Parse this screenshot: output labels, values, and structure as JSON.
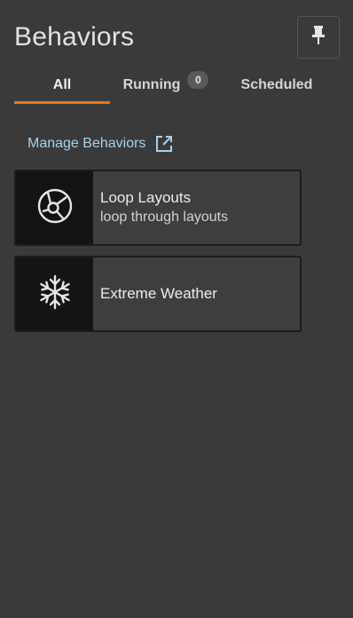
{
  "header": {
    "title": "Behaviors",
    "pin_icon": "pin-icon"
  },
  "tabs": [
    {
      "label": "All",
      "active": true
    },
    {
      "label": "Running",
      "badge": "0"
    },
    {
      "label": "Scheduled"
    }
  ],
  "manage_link": {
    "label": "Manage Behaviors",
    "icon": "external-link-icon",
    "color": "#a9d0ec"
  },
  "behaviors": [
    {
      "title": "Loop Layouts",
      "subtitle": "loop through layouts",
      "icon": "loop-layouts-icon"
    },
    {
      "title": "Extreme Weather",
      "subtitle": "",
      "icon": "snowflake-icon"
    }
  ],
  "colors": {
    "accent": "#e87722",
    "background": "#3a3a3a",
    "card_icon_bg": "#141414"
  }
}
